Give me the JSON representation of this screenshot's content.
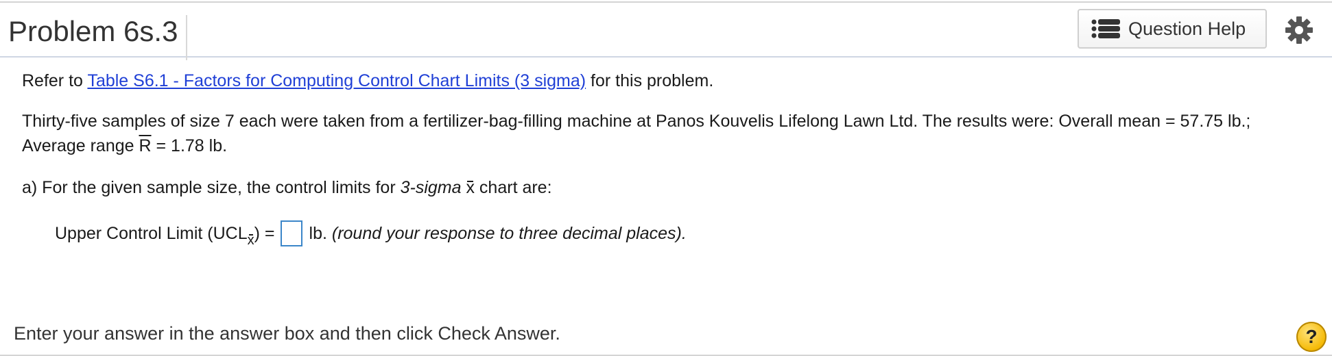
{
  "header": {
    "title": "Problem 6s.3",
    "help_button_label": "Question Help",
    "help_icon": "list-icon",
    "settings_icon": "gear-icon"
  },
  "problem": {
    "refer_prefix": "Refer to",
    "table_link": "Table S6.1 - Factors for Computing Control Chart Limits (3 sigma)",
    "refer_suffix": "for this problem.",
    "statement_part1": "Thirty-five samples of size 7 each were taken from a fertilizer-bag-filling machine at Panos Kouvelis Lifelong Lawn Ltd. The results were: Overall mean = 57.75 lb.; Average range ",
    "rbar_symbol": "R",
    "statement_part2": " = 1.78 lb.",
    "question_a_prefix": "a) For the given sample size, the control limits for ",
    "question_a_italic": "3-sigma",
    "xbar_symbol": "x",
    "question_a_suffix": " chart are:",
    "ucl_label": "Upper Control Limit (UCL",
    "ucl_subscript": "x",
    "ucl_close": ") =",
    "ucl_value": "",
    "ucl_unit": "lb.",
    "ucl_instruction": "(round your response to three decimal places)."
  },
  "footer": {
    "instruction": "Enter your answer in the answer box and then click Check Answer.",
    "help_symbol": "?"
  }
}
